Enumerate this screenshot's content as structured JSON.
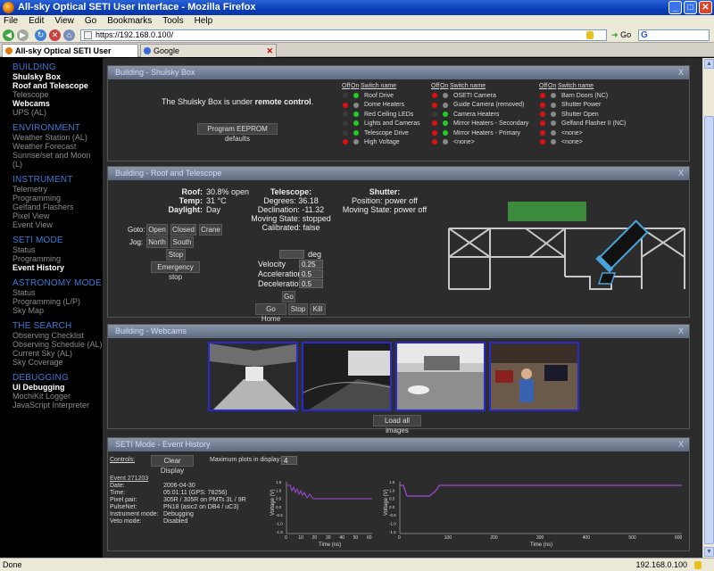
{
  "window": {
    "title": "All-sky Optical SETI User Interface - Mozilla Firefox"
  },
  "menu": [
    "File",
    "Edit",
    "View",
    "Go",
    "Bookmarks",
    "Tools",
    "Help"
  ],
  "toolbar": {
    "url": "https://192.168.0.100/",
    "go_label": "Go"
  },
  "tabs": [
    {
      "label": "All-sky Optical SETI User Interface",
      "active": true
    },
    {
      "label": "Google",
      "active": false
    }
  ],
  "sidebar": {
    "sections": [
      {
        "title": "BUILDING",
        "items": [
          {
            "label": "Shulsky Box",
            "active": true
          },
          {
            "label": "Roof and Telescope",
            "active": true
          },
          {
            "label": "Telescope",
            "active": false
          },
          {
            "label": "Webcams",
            "active": true
          },
          {
            "label": "UPS (AL)",
            "active": false
          }
        ]
      },
      {
        "title": "ENVIRONMENT",
        "items": [
          {
            "label": "Weather Station (AL)",
            "active": false
          },
          {
            "label": "Weather Forecast",
            "active": false
          },
          {
            "label": "Sunrise/set and Moon (L)",
            "active": false
          }
        ]
      },
      {
        "title": "INSTRUMENT",
        "items": [
          {
            "label": "Telemetry",
            "active": false
          },
          {
            "label": "Programming",
            "active": false
          },
          {
            "label": "Gelfand Flashers",
            "active": false
          },
          {
            "label": "Pixel View",
            "active": false
          },
          {
            "label": "Event View",
            "active": false
          }
        ]
      },
      {
        "title": "SETI MODE",
        "items": [
          {
            "label": "Status",
            "active": false
          },
          {
            "label": "Programming",
            "active": false
          },
          {
            "label": "Event History",
            "active": true
          }
        ]
      },
      {
        "title": "ASTRONOMY MODE",
        "items": [
          {
            "label": "Status",
            "active": false
          },
          {
            "label": "Programming (L/P)",
            "active": false
          },
          {
            "label": "Sky Map",
            "active": false
          }
        ]
      },
      {
        "title": "THE SEARCH",
        "items": [
          {
            "label": "Observing Checklist",
            "active": false
          },
          {
            "label": "Observing Schedule (AL)",
            "active": false
          },
          {
            "label": "Current Sky (AL)",
            "active": false
          },
          {
            "label": "Sky Coverage",
            "active": false
          }
        ]
      },
      {
        "title": "DEBUGGING",
        "items": [
          {
            "label": "UI Debugging",
            "active": true
          },
          {
            "label": "MochiKit Logger",
            "active": false
          },
          {
            "label": "JavaScript Interpreter",
            "active": false
          }
        ]
      }
    ]
  },
  "shulsky": {
    "title": "Building - Shulsky Box",
    "close": "X",
    "status_prefix": "The Shulsky Box is under ",
    "status_mode": "remote control",
    "status_suffix": ".",
    "program_button": "Program EEPROM defaults",
    "col_off": "Off",
    "col_on": "On",
    "col_name": "Switch name",
    "columns": [
      [
        {
          "off": "#3a3a3a",
          "on": "#22cc22",
          "name": "Roof Drive"
        },
        {
          "off": "#dd1111",
          "on": "#888888",
          "name": "Dome Heaters"
        },
        {
          "off": "#3a3a3a",
          "on": "#22cc22",
          "name": "Red Ceiling LEDs"
        },
        {
          "off": "#3a3a3a",
          "on": "#22cc22",
          "name": "Lights and Cameras"
        },
        {
          "off": "#3a3a3a",
          "on": "#22cc22",
          "name": "Telescope Drive"
        },
        {
          "off": "#dd1111",
          "on": "#888888",
          "name": "High Voltage"
        }
      ],
      [
        {
          "off": "#dd1111",
          "on": "#888888",
          "name": "OSETI Camera"
        },
        {
          "off": "#dd1111",
          "on": "#888888",
          "name": "Guide Camera (removed)"
        },
        {
          "off": "#3a3a3a",
          "on": "#22cc22",
          "name": "Camera Heaters"
        },
        {
          "off": "#dd1111",
          "on": "#22cc22",
          "name": "Mirror Heaters - Secondary"
        },
        {
          "off": "#dd1111",
          "on": "#22cc22",
          "name": "Mirror Heaters - Primary"
        },
        {
          "off": "#dd1111",
          "on": "#888888",
          "name": "<none>"
        }
      ],
      [
        {
          "off": "#dd1111",
          "on": "#888888",
          "name": "Barn Doors (NC)"
        },
        {
          "off": "#dd1111",
          "on": "#888888",
          "name": "Shutter Power"
        },
        {
          "off": "#dd1111",
          "on": "#888888",
          "name": "Shutter Open"
        },
        {
          "off": "#dd1111",
          "on": "#888888",
          "name": "Gelfand Flasher II (NC)"
        },
        {
          "off": "#dd1111",
          "on": "#888888",
          "name": "<none>"
        },
        {
          "off": "#dd1111",
          "on": "#888888",
          "name": "<none>"
        }
      ]
    ]
  },
  "roof": {
    "title": "Building - Roof and Telescope",
    "close": "X",
    "roof_label": "Roof:",
    "roof_value": "30.8% open",
    "temp_label": "Temp:",
    "temp_value": "31 °C",
    "daylight_label": "Daylight:",
    "daylight_value": "Day",
    "goto_label": "Goto:",
    "jog_label": "Jog:",
    "btn_open": "Open",
    "btn_closed": "Closed",
    "btn_crane": "Crane",
    "btn_north": "North",
    "btn_south": "South",
    "btn_stop": "Stop",
    "btn_estop": "Emergency stop",
    "telescope_header": "Telescope:",
    "tel_lines": [
      "Degrees: 36.18",
      "Declination: -11.32",
      "Moving State: stopped",
      "Calibrated: false"
    ],
    "shutter_header": "Shutter:",
    "shutter_lines": [
      "Position: power off",
      "Moving State: power off"
    ],
    "goto_to_label": "Go to",
    "goto_unit": "deg",
    "velocity_label": "Velocity",
    "velocity_value": "0.25",
    "accel_label": "Acceleration",
    "accel_value": "0.5",
    "decel_label": "Deceleration",
    "decel_value": "0.5",
    "btn_go": "Go",
    "btn_gohome": "Go Home",
    "btn_tstop": "Stop",
    "btn_kill": "Kill",
    "roof_open_fraction": 0.308
  },
  "webcams": {
    "title": "Building - Webcams",
    "close": "X",
    "load_button": "Load all images",
    "count": 4
  },
  "events": {
    "title": "SETI Mode - Event History",
    "close": "X",
    "controls_label": "Controls:",
    "clear_button": "Clear Display",
    "max_plots_label": "Maximum plots in display:",
    "max_plots_value": "4",
    "event_link": "Event 271203",
    "rows": [
      {
        "k": "Date:",
        "v": "2006-04-30"
      },
      {
        "k": "Time:",
        "v": "05:01:11 (GPS: 78256)"
      },
      {
        "k": "Pixel pair:",
        "v": "305R / 305R on PMTs 3L / 9R"
      },
      {
        "k": "PulseNet:",
        "v": "PN18 (asic2 on DB4 / uC3)"
      },
      {
        "k": "Instrument mode:",
        "v": "Debugging"
      },
      {
        "k": "Veto mode:",
        "v": "Disabled"
      }
    ],
    "ylabel": "Voltage (V)",
    "xlabel": "Time (ns)",
    "plot1_xticks": [
      "0",
      "10",
      "20",
      "30",
      "40",
      "50",
      "60"
    ],
    "plot2_xticks": [
      "0",
      "100",
      "200",
      "300",
      "400",
      "500",
      "600"
    ],
    "yticks": [
      "1.5",
      "1.0",
      "0.5",
      "0.0",
      "-0.5",
      "-1.0",
      "-1.5"
    ]
  },
  "status": {
    "left": "Done",
    "right": "192.168.0.100"
  }
}
